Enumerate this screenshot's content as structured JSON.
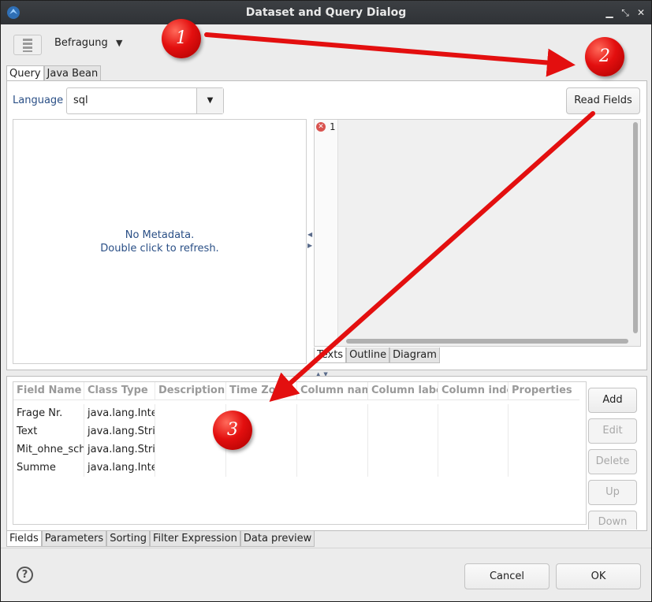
{
  "window": {
    "title": "Dataset and Query Dialog"
  },
  "toolbar": {
    "dataset_name": "Befragung"
  },
  "top_tabs": [
    "Query",
    "Java Bean"
  ],
  "query": {
    "language_label": "Language",
    "language_value": "sql",
    "read_fields_label": "Read Fields",
    "metadata_line1": "No Metadata.",
    "metadata_line2": "Double click to refresh.",
    "editor_line_number": "1",
    "editor_tabs": [
      "Texts",
      "Outline",
      "Diagram"
    ]
  },
  "fields_table": {
    "columns": [
      "Field Name",
      "Class Type",
      "Description",
      "Time Zone",
      "Column name",
      "Column label",
      "Column index",
      "Properties"
    ],
    "rows": [
      [
        "Frage Nr.",
        "java.lang.Integer",
        "",
        "",
        "",
        "",
        "",
        ""
      ],
      [
        "Text",
        "java.lang.String",
        "",
        "",
        "",
        "",
        "",
        ""
      ],
      [
        "Mit_ohne_schulung",
        "java.lang.String",
        "",
        "",
        "",
        "",
        "",
        ""
      ],
      [
        "Summe",
        "java.lang.Integer",
        "",
        "",
        "",
        "",
        "",
        ""
      ]
    ]
  },
  "field_buttons": {
    "add": "Add",
    "edit": "Edit",
    "delete": "Delete",
    "up": "Up",
    "down": "Down"
  },
  "bottom_tabs": [
    "Fields",
    "Parameters",
    "Sorting",
    "Filter Expression",
    "Data preview"
  ],
  "footer": {
    "help": "?",
    "cancel": "Cancel",
    "ok": "OK"
  },
  "annotations": [
    "1",
    "2",
    "3"
  ],
  "colors": {
    "annotation_red": "#e30f0f",
    "link_blue": "#2a4f86"
  }
}
